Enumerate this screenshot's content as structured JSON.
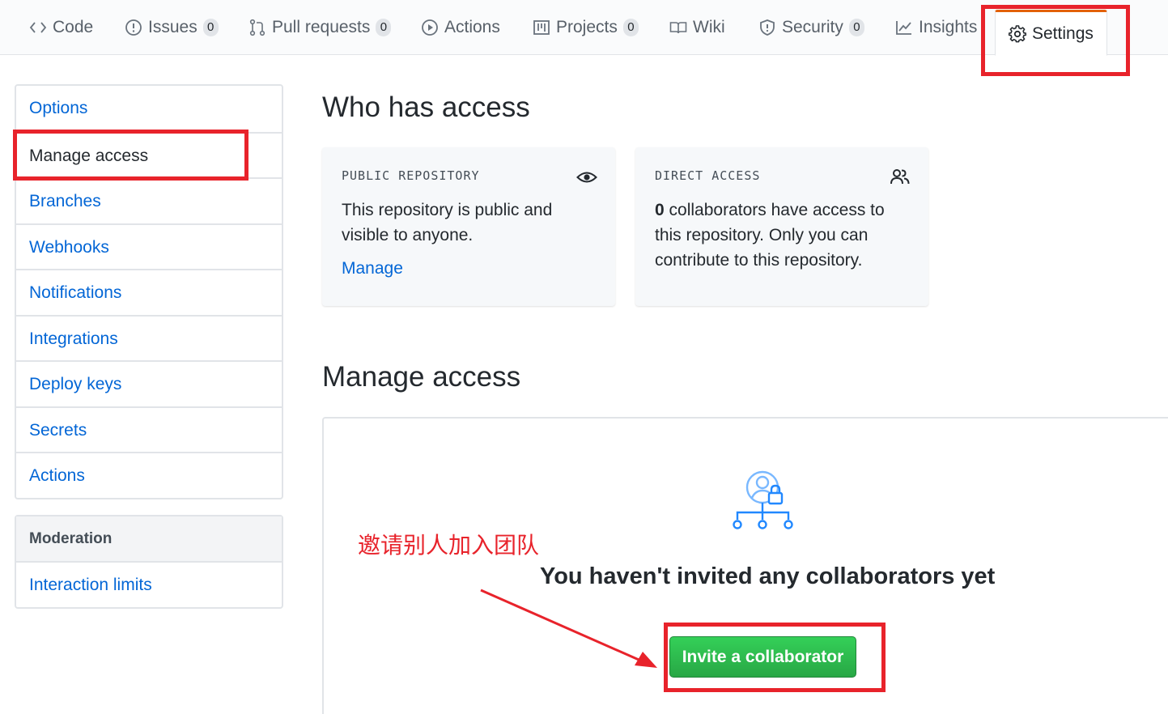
{
  "tabs": [
    {
      "label": "Code",
      "icon": "code-icon"
    },
    {
      "label": "Issues",
      "count": "0",
      "icon": "issue-icon"
    },
    {
      "label": "Pull requests",
      "count": "0",
      "icon": "pull-request-icon"
    },
    {
      "label": "Actions",
      "icon": "play-icon"
    },
    {
      "label": "Projects",
      "count": "0",
      "icon": "project-icon"
    },
    {
      "label": "Wiki",
      "icon": "book-icon"
    },
    {
      "label": "Security",
      "count": "0",
      "icon": "shield-icon"
    },
    {
      "label": "Insights",
      "icon": "graph-icon"
    },
    {
      "label": "Settings",
      "icon": "gear-icon",
      "selected": true
    }
  ],
  "menu": {
    "items": [
      "Options",
      "Manage access",
      "Branches",
      "Webhooks",
      "Notifications",
      "Integrations",
      "Deploy keys",
      "Secrets",
      "Actions"
    ],
    "selected": "Manage access"
  },
  "moderation": {
    "heading": "Moderation",
    "items": [
      "Interaction limits"
    ]
  },
  "who_has_access": {
    "title": "Who has access",
    "public_card": {
      "title": "PUBLIC REPOSITORY",
      "text": "This repository is public and visible to anyone.",
      "link": "Manage",
      "icon": "eye-icon"
    },
    "direct_card": {
      "title": "DIRECT ACCESS",
      "count": "0",
      "text": " collaborators have access to this repository. Only you can contribute to this repository.",
      "icon": "people-icon"
    }
  },
  "manage_access": {
    "title": "Manage access",
    "empty_message": "You haven't invited any collaborators yet",
    "invite_button": "Invite a collaborator",
    "icon": "person-lock-icon"
  },
  "annotation": {
    "note": "邀请别人加入团队",
    "color": "#e8232b"
  },
  "colors": {
    "link": "#0366d6",
    "button_green": "#2ea44f",
    "accent_tab": "#e36209"
  }
}
